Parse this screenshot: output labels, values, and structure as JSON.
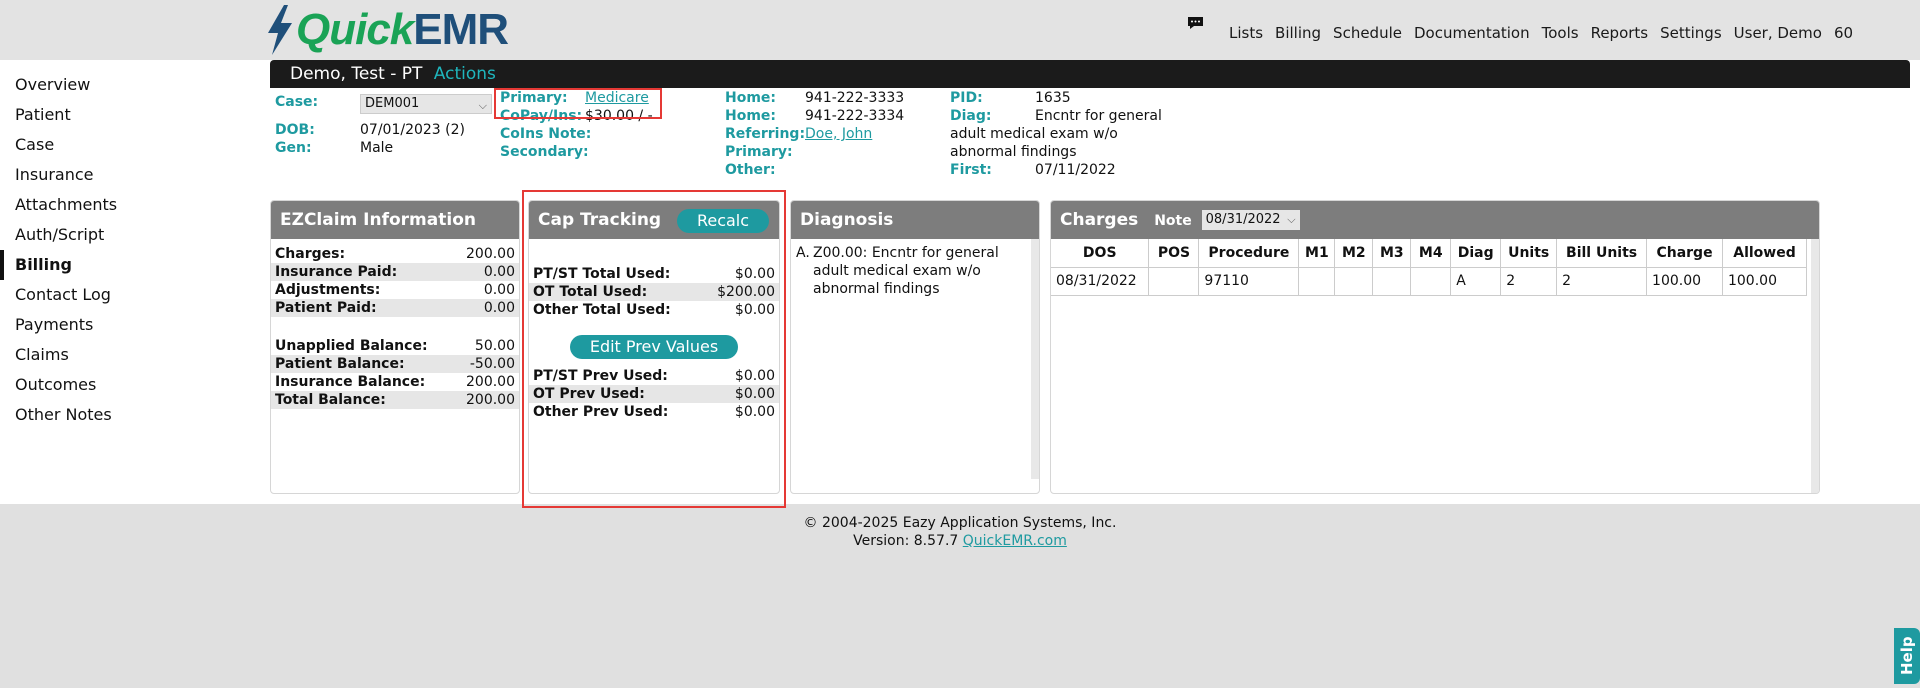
{
  "brand": {
    "part1": "Quick",
    "part2": "EMR"
  },
  "nav": [
    "Lists",
    "Billing",
    "Schedule",
    "Documentation",
    "Tools",
    "Reports",
    "Settings",
    "User, Demo",
    "60"
  ],
  "sidebar": [
    {
      "label": "Overview"
    },
    {
      "label": "Patient"
    },
    {
      "label": "Case"
    },
    {
      "label": "Insurance"
    },
    {
      "label": "Attachments"
    },
    {
      "label": "Auth/Script"
    },
    {
      "label": "Billing",
      "active": true
    },
    {
      "label": "Contact Log"
    },
    {
      "label": "Payments"
    },
    {
      "label": "Claims"
    },
    {
      "label": "Outcomes"
    },
    {
      "label": "Other Notes"
    }
  ],
  "patient": {
    "name": "Demo, Test - PT",
    "actions_label": "Actions",
    "case_label": "Case:",
    "case_value": "DEM001",
    "dob_label": "DOB:",
    "dob_value": "07/01/2023 (2)",
    "gen_label": "Gen:",
    "gen_value": "Male",
    "primary_label": "Primary:",
    "primary_value": "Medicare",
    "copay_label": "CoPay/Ins:",
    "copay_value": "$30.00 / -",
    "coins_label": "CoIns Note:",
    "secondary_label": "Secondary:",
    "home1_label": "Home:",
    "home1_value": "941-222-3333",
    "home2_label": "Home:",
    "home2_value": "941-222-3334",
    "referring_label": "Referring:",
    "referring_value": "Doe, John",
    "primary2_label": "Primary:",
    "other_label": "Other:",
    "pid_label": "PID:",
    "pid_value": "1635",
    "diag_label": "Diag:",
    "diag_value_1": "Encntr for general",
    "diag_value_2": "adult medical exam w/o",
    "diag_value_3": "abnormal findings",
    "first_label": "First:",
    "first_value": "07/11/2022"
  },
  "ezclaim": {
    "title": "EZClaim Information",
    "rows1": [
      {
        "k": "Charges:",
        "v": "200.00"
      },
      {
        "k": "Insurance Paid:",
        "v": "0.00"
      },
      {
        "k": "Adjustments:",
        "v": "0.00"
      },
      {
        "k": "Patient Paid:",
        "v": "0.00"
      }
    ],
    "rows2": [
      {
        "k": "Unapplied Balance:",
        "v": "50.00"
      },
      {
        "k": "Patient Balance:",
        "v": "-50.00"
      },
      {
        "k": "Insurance Balance:",
        "v": "200.00"
      },
      {
        "k": "Total Balance:",
        "v": "200.00"
      }
    ]
  },
  "cap": {
    "title": "Cap Tracking",
    "recalc_label": "Recalc",
    "edit_label": "Edit Prev Values",
    "rows1": [
      {
        "k": "PT/ST Total Used:",
        "v": "$0.00"
      },
      {
        "k": "OT Total Used:",
        "v": "$200.00"
      },
      {
        "k": "Other Total Used:",
        "v": "$0.00"
      }
    ],
    "rows2": [
      {
        "k": "PT/ST Prev Used:",
        "v": "$0.00"
      },
      {
        "k": "OT Prev Used:",
        "v": "$0.00"
      },
      {
        "k": "Other Prev Used:",
        "v": "$0.00"
      }
    ]
  },
  "diagnosis": {
    "title": "Diagnosis",
    "prefix": "A.",
    "line1": "Z00.00: Encntr for general",
    "line2": "adult medical exam w/o",
    "line3": "abnormal findings"
  },
  "charges": {
    "title": "Charges",
    "note_label": "Note",
    "note_value": "08/31/2022",
    "columns": [
      "DOS",
      "POS",
      "Procedure",
      "M1",
      "M2",
      "M3",
      "M4",
      "Diag",
      "Units",
      "Bill Units",
      "Charge",
      "Allowed"
    ],
    "rows": [
      [
        "08/31/2022",
        "",
        "97110",
        "",
        "",
        "",
        "",
        "A",
        "2",
        "2",
        "100.00",
        "100.00"
      ]
    ]
  },
  "footer": {
    "copyright": "© 2004-2025 Eazy Application Systems, Inc.",
    "version_label": "Version: 8.57.7",
    "link": "QuickEMR.com"
  },
  "help_label": "Help",
  "colors": {
    "teal": "#1e9aa0",
    "dark_bar": "#1b1b1b",
    "panel_header": "#7d7d7d",
    "highlight": "#e53935"
  }
}
